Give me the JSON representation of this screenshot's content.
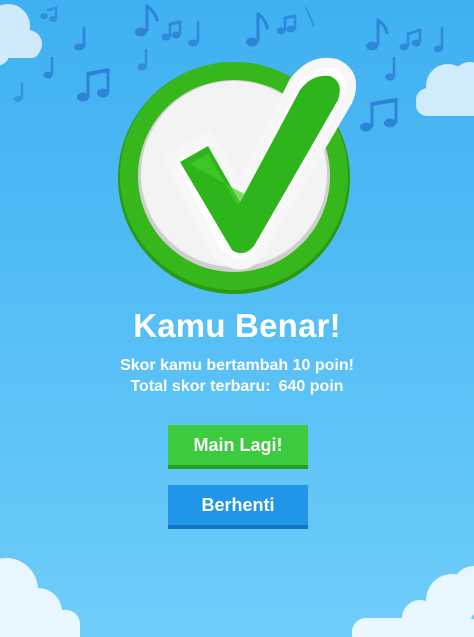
{
  "result": {
    "title": "Kamu Benar!",
    "score_added_text": "Skor kamu bertambah 10 poin!",
    "total_label": "Total skor terbaru:",
    "total_value": "640 poin"
  },
  "buttons": {
    "play_again": "Main Lagi!",
    "stop": "Berhenti"
  },
  "icons": {
    "badge": "checkmark-badge-icon",
    "decoration": "music-note-icon"
  },
  "colors": {
    "background_top": "#3fb0f1",
    "background_bottom": "#6fcdfa",
    "check_green": "#34b81b",
    "play_again_button": "#3ccb3e",
    "stop_button": "#2196e8"
  }
}
